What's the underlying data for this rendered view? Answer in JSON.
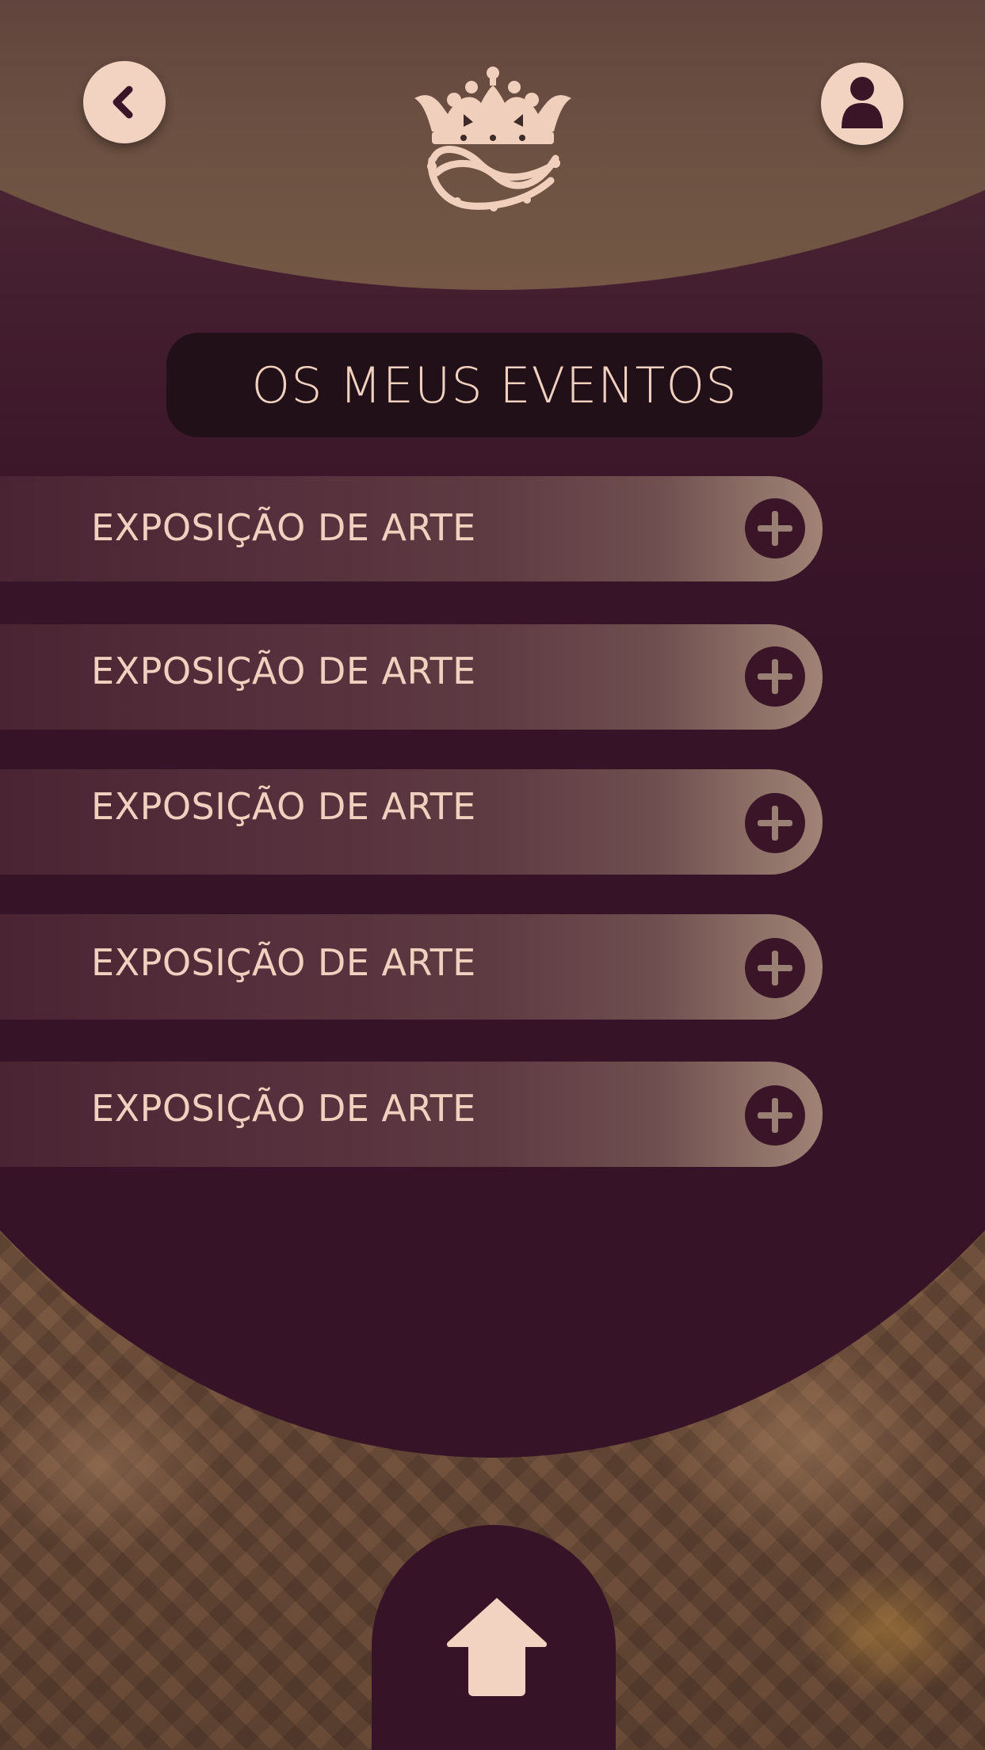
{
  "header": {
    "back_icon": "chevron-left-icon",
    "logo_icon": "crown-of-thorns-icon",
    "profile_icon": "user-icon"
  },
  "title": "OS MEUS EVENTOS",
  "events": [
    {
      "label": "EXPOSIÇÃO DE ARTE",
      "action_icon": "plus-circle-icon"
    },
    {
      "label": "EXPOSIÇÃO DE ARTE",
      "action_icon": "plus-circle-icon"
    },
    {
      "label": "EXPOSIÇÃO DE ARTE",
      "action_icon": "plus-circle-icon"
    },
    {
      "label": "EXPOSIÇÃO DE ARTE",
      "action_icon": "plus-circle-icon"
    },
    {
      "label": "EXPOSIÇÃO DE ARTE",
      "action_icon": "plus-circle-icon"
    }
  ],
  "bottom_nav": {
    "home_icon": "home-arrow-icon"
  },
  "colors": {
    "plum": "#361327",
    "cream": "#f2d2c1",
    "title_box": "#221018",
    "header_brown": "#745845"
  }
}
